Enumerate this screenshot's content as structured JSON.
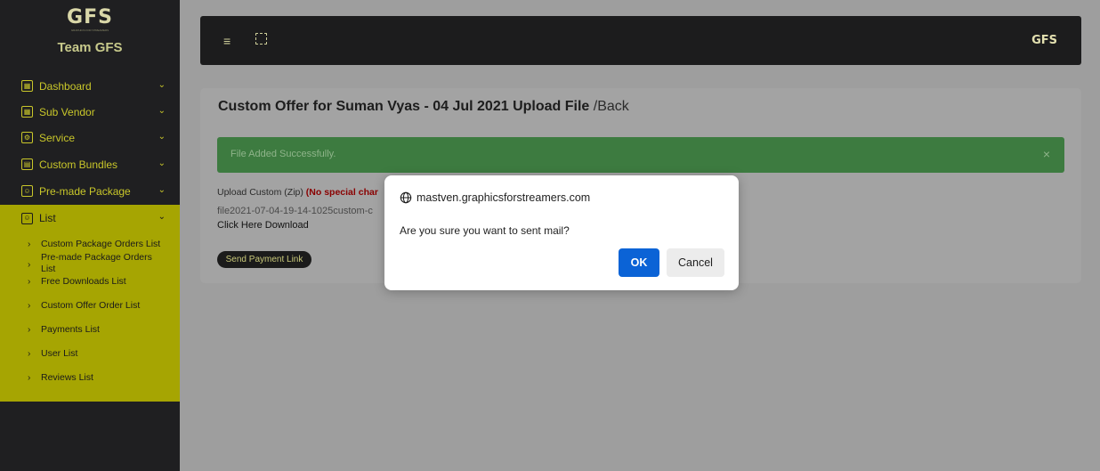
{
  "sidebar": {
    "logo": "GFS",
    "logo_sub": "GRAPHICS FOR STREAMERS",
    "team": "Team GFS",
    "items": [
      {
        "label": "Dashboard",
        "icon": "dashboard-icon"
      },
      {
        "label": "Sub Vendor",
        "icon": "vendor-icon"
      },
      {
        "label": "Service",
        "icon": "service-icon"
      },
      {
        "label": "Custom Bundles",
        "icon": "bundles-icon"
      },
      {
        "label": "Pre-made Package",
        "icon": "package-icon"
      },
      {
        "label": "List",
        "icon": "list-icon"
      }
    ],
    "sub_items": [
      "Custom Package Orders List",
      "Pre-made Package Orders",
      "List",
      "Free Downloads List",
      "Custom Offer Order List",
      "Payments List",
      "User List",
      "Reviews List"
    ]
  },
  "header": {
    "logo": "GFS"
  },
  "card": {
    "title": "Custom Offer for Suman Vyas - 04 Jul 2021 Upload File",
    "back": "/Back",
    "alert": "File Added Successfully.",
    "alert_close": "×",
    "upload_label": "Upload Custom (Zip)",
    "upload_warning": "(No special char",
    "file_name": "file2021-07-04-19-14-1025custom-c",
    "download": "Click Here Download",
    "payment_button": "Send Payment Link"
  },
  "dialog": {
    "origin": "mastven.graphicsforstreamers.com",
    "message": "Are you sure you want to sent mail?",
    "ok": "OK",
    "cancel": "Cancel"
  },
  "colors": {
    "sidebar_bg": "#1f1f21",
    "accent": "#a6a502",
    "alert_green": "#3d7b40",
    "ok_blue": "#0b63d6"
  }
}
